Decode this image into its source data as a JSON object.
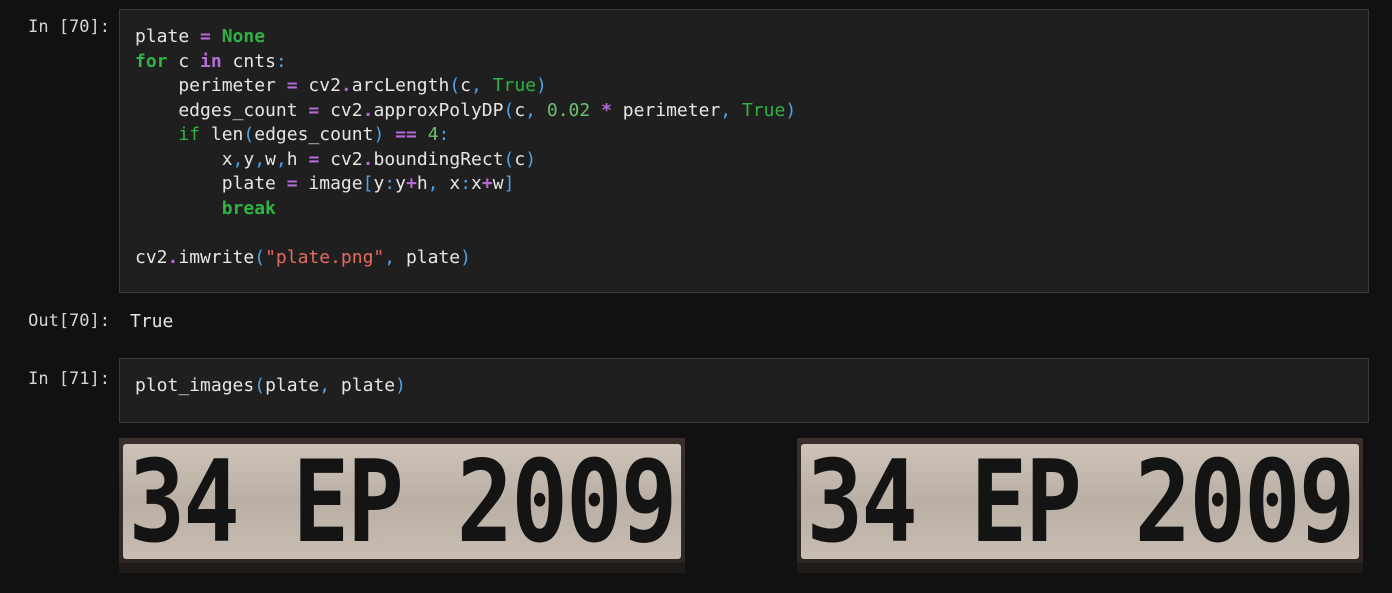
{
  "cells": [
    {
      "prompt": "In [70]:",
      "code_lines": [
        [
          {
            "t": "plate ",
            "c": ""
          },
          {
            "t": "=",
            "c": "op"
          },
          {
            "t": " ",
            "c": ""
          },
          {
            "t": "None",
            "c": "kw"
          }
        ],
        [
          {
            "t": "for",
            "c": "kw"
          },
          {
            "t": " c ",
            "c": ""
          },
          {
            "t": "in",
            "c": "op"
          },
          {
            "t": " cnts",
            "c": ""
          },
          {
            "t": ":",
            "c": "pun"
          }
        ],
        [
          {
            "t": "    perimeter ",
            "c": ""
          },
          {
            "t": "=",
            "c": "op"
          },
          {
            "t": " cv2",
            "c": ""
          },
          {
            "t": ".",
            "c": "op"
          },
          {
            "t": "arcLength",
            "c": ""
          },
          {
            "t": "(",
            "c": "pun"
          },
          {
            "t": "c",
            "c": ""
          },
          {
            "t": ",",
            "c": "pun"
          },
          {
            "t": " ",
            "c": ""
          },
          {
            "t": "True",
            "c": "kw2"
          },
          {
            "t": ")",
            "c": "pun"
          }
        ],
        [
          {
            "t": "    edges_count ",
            "c": ""
          },
          {
            "t": "=",
            "c": "op"
          },
          {
            "t": " cv2",
            "c": ""
          },
          {
            "t": ".",
            "c": "op"
          },
          {
            "t": "approxPolyDP",
            "c": ""
          },
          {
            "t": "(",
            "c": "pun"
          },
          {
            "t": "c",
            "c": ""
          },
          {
            "t": ",",
            "c": "pun"
          },
          {
            "t": " ",
            "c": ""
          },
          {
            "t": "0.02",
            "c": "num"
          },
          {
            "t": " ",
            "c": ""
          },
          {
            "t": "*",
            "c": "op"
          },
          {
            "t": " perimeter",
            "c": ""
          },
          {
            "t": ",",
            "c": "pun"
          },
          {
            "t": " ",
            "c": ""
          },
          {
            "t": "True",
            "c": "kw2"
          },
          {
            "t": ")",
            "c": "pun"
          }
        ],
        [
          {
            "t": "    ",
            "c": ""
          },
          {
            "t": "if",
            "c": "kw2"
          },
          {
            "t": " len",
            "c": ""
          },
          {
            "t": "(",
            "c": "pun"
          },
          {
            "t": "edges_count",
            "c": ""
          },
          {
            "t": ")",
            "c": "pun"
          },
          {
            "t": " ",
            "c": ""
          },
          {
            "t": "==",
            "c": "op"
          },
          {
            "t": " ",
            "c": ""
          },
          {
            "t": "4",
            "c": "num"
          },
          {
            "t": ":",
            "c": "pun"
          }
        ],
        [
          {
            "t": "        x",
            "c": ""
          },
          {
            "t": ",",
            "c": "pun"
          },
          {
            "t": "y",
            "c": ""
          },
          {
            "t": ",",
            "c": "pun"
          },
          {
            "t": "w",
            "c": ""
          },
          {
            "t": ",",
            "c": "pun"
          },
          {
            "t": "h ",
            "c": ""
          },
          {
            "t": "=",
            "c": "op"
          },
          {
            "t": " cv2",
            "c": ""
          },
          {
            "t": ".",
            "c": "op"
          },
          {
            "t": "boundingRect",
            "c": ""
          },
          {
            "t": "(",
            "c": "pun"
          },
          {
            "t": "c",
            "c": ""
          },
          {
            "t": ")",
            "c": "pun"
          }
        ],
        [
          {
            "t": "        plate ",
            "c": ""
          },
          {
            "t": "=",
            "c": "op"
          },
          {
            "t": " image",
            "c": ""
          },
          {
            "t": "[",
            "c": "pun"
          },
          {
            "t": "y",
            "c": ""
          },
          {
            "t": ":",
            "c": "pun"
          },
          {
            "t": "y",
            "c": ""
          },
          {
            "t": "+",
            "c": "op"
          },
          {
            "t": "h",
            "c": ""
          },
          {
            "t": ",",
            "c": "pun"
          },
          {
            "t": " x",
            "c": ""
          },
          {
            "t": ":",
            "c": "pun"
          },
          {
            "t": "x",
            "c": ""
          },
          {
            "t": "+",
            "c": "op"
          },
          {
            "t": "w",
            "c": ""
          },
          {
            "t": "]",
            "c": "pun"
          }
        ],
        [
          {
            "t": "        ",
            "c": ""
          },
          {
            "t": "break",
            "c": "kw"
          }
        ],
        [
          {
            "t": "",
            "c": ""
          }
        ],
        [
          {
            "t": "cv2",
            "c": ""
          },
          {
            "t": ".",
            "c": "op"
          },
          {
            "t": "imwrite",
            "c": ""
          },
          {
            "t": "(",
            "c": "pun"
          },
          {
            "t": "\"plate.png\"",
            "c": "str"
          },
          {
            "t": ",",
            "c": "pun"
          },
          {
            "t": " plate",
            "c": ""
          },
          {
            "t": ")",
            "c": "pun"
          }
        ]
      ]
    },
    {
      "prompt": "In [71]:",
      "code_lines": [
        [
          {
            "t": "plot_images",
            "c": ""
          },
          {
            "t": "(",
            "c": "pun"
          },
          {
            "t": "plate",
            "c": ""
          },
          {
            "t": ",",
            "c": "pun"
          },
          {
            "t": " plate",
            "c": ""
          },
          {
            "t": ")",
            "c": "pun"
          }
        ]
      ]
    }
  ],
  "output": {
    "prompt": "Out[70]:",
    "value": "True"
  },
  "images": [
    {
      "icon": "license-plate-image",
      "text": "34 EP 2009"
    },
    {
      "icon": "license-plate-image",
      "text": "34 EP 2009"
    }
  ]
}
